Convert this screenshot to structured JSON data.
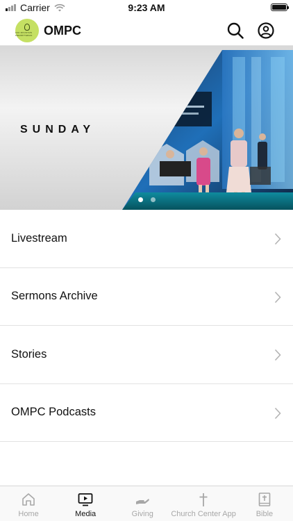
{
  "status": {
    "carrier": "Carrier",
    "time": "9:23 AM"
  },
  "header": {
    "title": "OMPC",
    "logo_text": "OAK MOUNTAIN PRESBYTERIAN"
  },
  "hero": {
    "title": "SUNDAY",
    "slide_count": 2,
    "active_slide": 1
  },
  "menu": [
    {
      "label": "Livestream"
    },
    {
      "label": "Sermons Archive"
    },
    {
      "label": "Stories"
    },
    {
      "label": "OMPC Podcasts"
    }
  ],
  "tabs": [
    {
      "label": "Home",
      "icon": "home-icon",
      "active": false
    },
    {
      "label": "Media",
      "icon": "play-screen-icon",
      "active": true
    },
    {
      "label": "Giving",
      "icon": "giving-hand-icon",
      "active": false
    },
    {
      "label": "Church Center App",
      "icon": "cross-icon",
      "active": false
    },
    {
      "label": "Bible",
      "icon": "bible-icon",
      "active": false
    }
  ],
  "colors": {
    "logo_bg": "#c5e063",
    "active_tab": "#111111",
    "inactive_tab": "#a7a7a7"
  }
}
